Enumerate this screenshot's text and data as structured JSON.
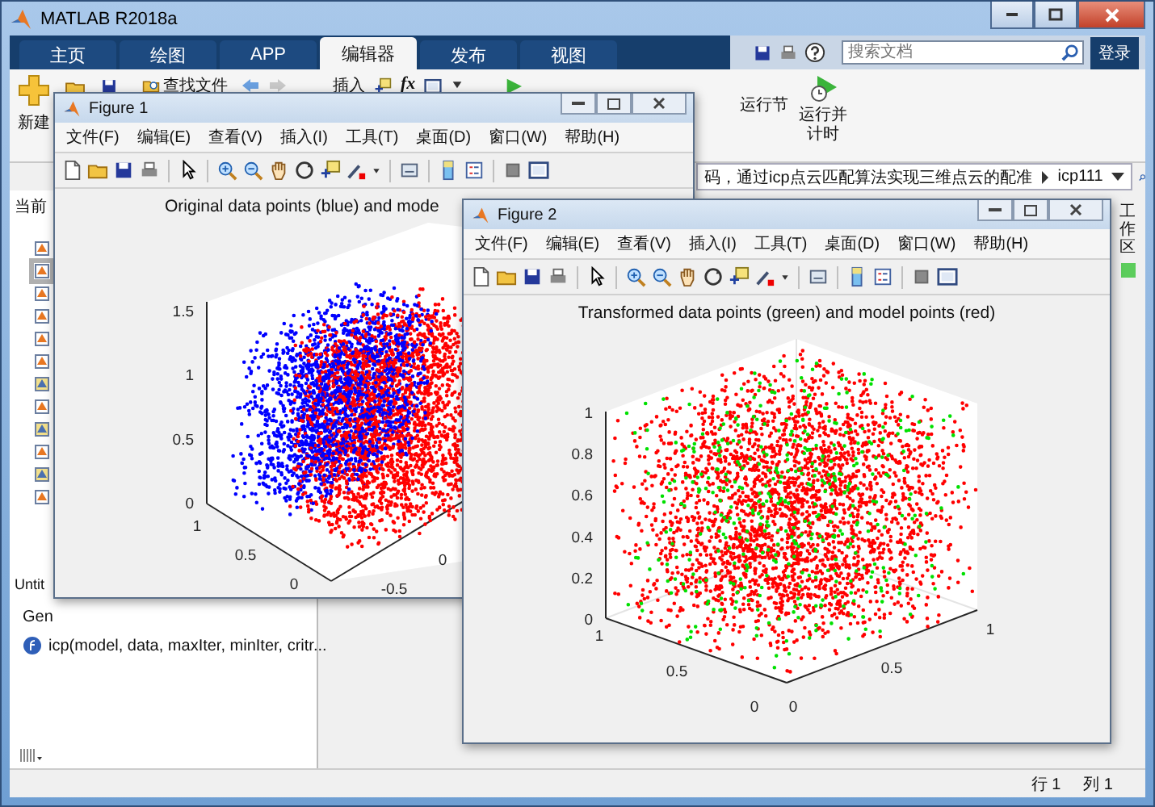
{
  "window": {
    "title": "MATLAB R2018a"
  },
  "ribbon_tabs": [
    {
      "label": "主页",
      "selected": false
    },
    {
      "label": "绘图",
      "selected": false
    },
    {
      "label": "APP",
      "selected": false
    },
    {
      "label": "编辑器",
      "selected": true
    },
    {
      "label": "发布",
      "selected": false
    },
    {
      "label": "视图",
      "selected": false
    }
  ],
  "search": {
    "placeholder": "搜索文档"
  },
  "login": "登录",
  "ribbon": {
    "new": "新建",
    "find_files": "查找文件",
    "insert": "插入",
    "fx": "fx",
    "run_section": "运行节",
    "run_and_time": "运行并计时"
  },
  "address_bar": {
    "path": "码，通过icp点云匹配算法实现三维点云的配准",
    "folder": "icp111"
  },
  "current_folder": {
    "header": "当前"
  },
  "details": {
    "title": "Untit",
    "label": "Gen",
    "signature": "icp(model, data, maxIter, minIter, critr..."
  },
  "workspace_tab": "工作区",
  "figures": [
    {
      "kind": "two_clouds",
      "title": "Figure 1",
      "menus": [
        "文件(F)",
        "编辑(E)",
        "查看(V)",
        "插入(I)",
        "工具(T)",
        "桌面(D)",
        "窗口(W)",
        "帮助(H)"
      ],
      "plot_title": "Original data points (blue) and mode",
      "z_ticks": [
        "1.5",
        "1",
        "0.5",
        "0"
      ],
      "y_ticks": [
        "1",
        "0.5",
        "0"
      ],
      "x_ticks": [
        "-0.5",
        "0"
      ]
    },
    {
      "kind": "cube",
      "title": "Figure 2",
      "menus": [
        "文件(F)",
        "编辑(E)",
        "查看(V)",
        "插入(I)",
        "工具(T)",
        "桌面(D)",
        "窗口(W)",
        "帮助(H)"
      ],
      "plot_title": "Transformed data points (green) and model points (red)",
      "z_ticks": [
        "1",
        "0.8",
        "0.6",
        "0.4",
        "0.2",
        "0"
      ],
      "y_ticks": [
        "1",
        "0.5",
        "0"
      ],
      "x_ticks": [
        "0",
        "0.5",
        "1"
      ]
    }
  ],
  "status_bar": {
    "row": "行 1",
    "col": "列 1"
  }
}
